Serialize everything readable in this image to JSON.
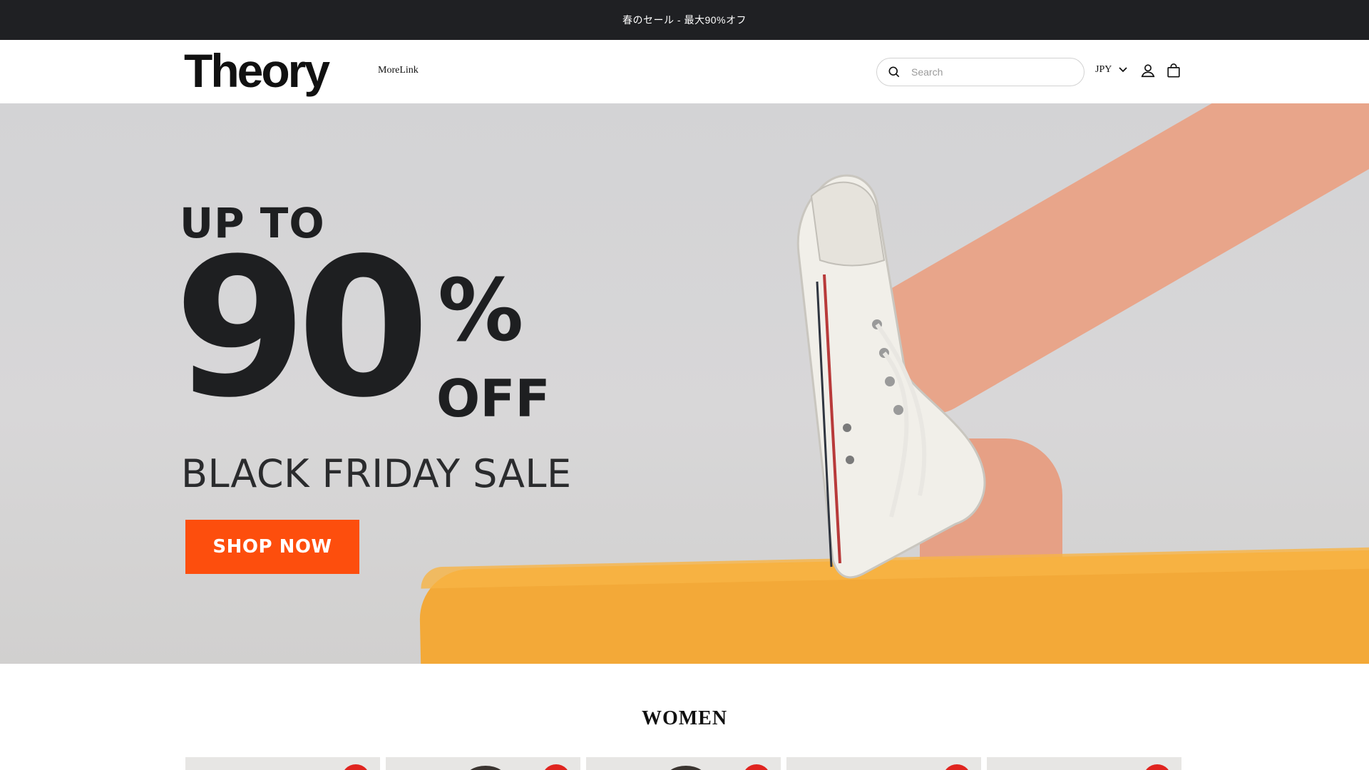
{
  "announcement": {
    "text": "春のセール - 最大90%オフ"
  },
  "header": {
    "logo": "Theory",
    "nav_link": "MoreLink",
    "search_placeholder": "Search",
    "currency": "JPY"
  },
  "hero": {
    "line1": "UP TO",
    "big_number": "90",
    "percent": "%",
    "off": "OFF",
    "subtitle": "BLACK FRIDAY SALE",
    "cta": "SHOP NOW"
  },
  "section": {
    "title": "WOMEN"
  },
  "products": [
    {},
    {},
    {},
    {},
    {}
  ],
  "colors": {
    "announcement_bg": "#1f2023",
    "cta": "#fd4e0d",
    "cushion": "#f3a938",
    "badge": "#e0241f"
  }
}
